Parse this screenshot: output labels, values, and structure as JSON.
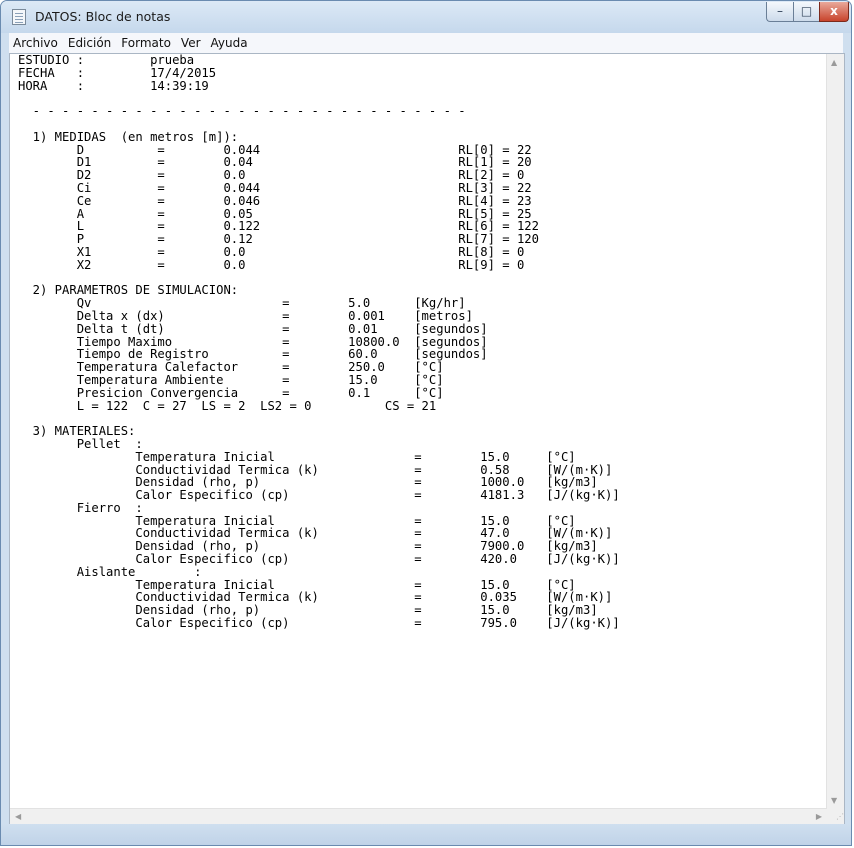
{
  "window": {
    "title": "DATOS: Bloc de notas",
    "controls": {
      "minimize": "–",
      "maximize": "□",
      "close": "x"
    }
  },
  "menu": {
    "items": [
      "Archivo",
      "Edición",
      "Formato",
      "Ver",
      "Ayuda"
    ]
  },
  "document": {
    "content": "ESTUDIO :         prueba\nFECHA   :         17/4/2015\nHORA    :         14:39:19\n\n  - - - - - - - - - - - - - - - - - - - - - - - - - - - - - -\n\n  1) MEDIDAS  (en metros [m]):\n        D          =        0.044                           RL[0] = 22\n        D1         =        0.04                            RL[1] = 20\n        D2         =        0.0                             RL[2] = 0\n        Ci         =        0.044                           RL[3] = 22\n        Ce         =        0.046                           RL[4] = 23\n        A          =        0.05                            RL[5] = 25\n        L          =        0.122                           RL[6] = 122\n        P          =        0.12                            RL[7] = 120\n        X1         =        0.0                             RL[8] = 0\n        X2         =        0.0                             RL[9] = 0\n\n  2) PARAMETROS DE SIMULACION:\n        Qv                          =        5.0      [Kg/hr]\n        Delta x (dx)                =        0.001    [metros]\n        Delta t (dt)                =        0.01     [segundos]\n        Tiempo Maximo               =        10800.0  [segundos]\n        Tiempo de Registro          =        60.0     [segundos]\n        Temperatura Calefactor      =        250.0    [°C]\n        Temperatura Ambiente        =        15.0     [°C]\n        Presicion Convergencia      =        0.1      [°C]\n        L = 122  C = 27  LS = 2  LS2 = 0          CS = 21\n\n  3) MATERIALES:\n        Pellet  :\n                Temperatura Inicial                   =        15.0     [°C]\n                Conductividad Termica (k)             =        0.58     [W/(m·K)]\n                Densidad (rho, p)                     =        1000.0   [kg/m3]\n                Calor Especifico (cp)                 =        4181.3   [J/(kg·K)]\n        Fierro  :\n                Temperatura Inicial                   =        15.0     [°C]\n                Conductividad Termica (k)             =        47.0     [W/(m·K)]\n                Densidad (rho, p)                     =        7900.0   [kg/m3]\n                Calor Especifico (cp)                 =        420.0    [J/(kg·K)]\n        Aislante        :\n                Temperatura Inicial                   =        15.0     [°C]\n                Conductividad Termica (k)             =        0.035    [W/(m·K)]\n                Densidad (rho, p)                     =        15.0     [kg/m3]\n                Calor Especifico (cp)                 =        795.0    [J/(kg·K)]"
  }
}
